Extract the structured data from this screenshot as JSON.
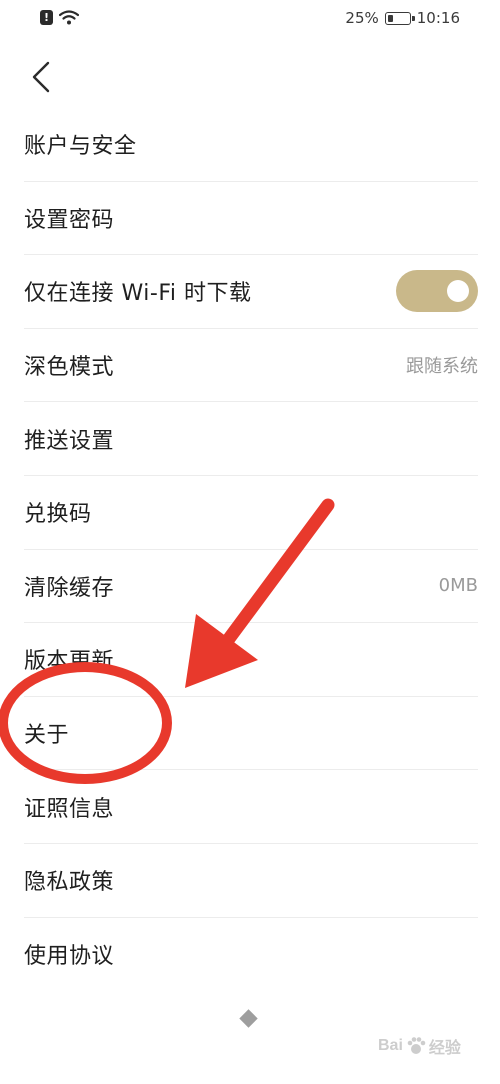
{
  "status_bar": {
    "battery_text": "25%",
    "battery_level": 0.25,
    "time": "10:16",
    "alert_icon": "alert-icon",
    "wifi_icon": "wifi-icon"
  },
  "header": {
    "back_icon": "chevron-left-icon"
  },
  "settings": {
    "items": [
      {
        "label": "账户与安全"
      },
      {
        "label": "设置密码"
      },
      {
        "label": "仅在连接 Wi-Fi 时下载",
        "toggle_on": true
      },
      {
        "label": "深色模式",
        "value": "跟随系统"
      },
      {
        "label": "推送设置"
      },
      {
        "label": "兑换码"
      },
      {
        "label": "清除缓存",
        "value": "0MB"
      },
      {
        "label": "版本更新"
      },
      {
        "label": "关于"
      },
      {
        "label": "证照信息"
      },
      {
        "label": "隐私政策"
      },
      {
        "label": "使用协议"
      }
    ]
  },
  "annotation": {
    "color": "#e8392c"
  },
  "watermark": {
    "text": "Bai",
    "suffix": "经验"
  },
  "colors": {
    "toggle_on": "#c9b88a",
    "divider": "#ececec",
    "secondary_text": "#9a9a9a"
  }
}
